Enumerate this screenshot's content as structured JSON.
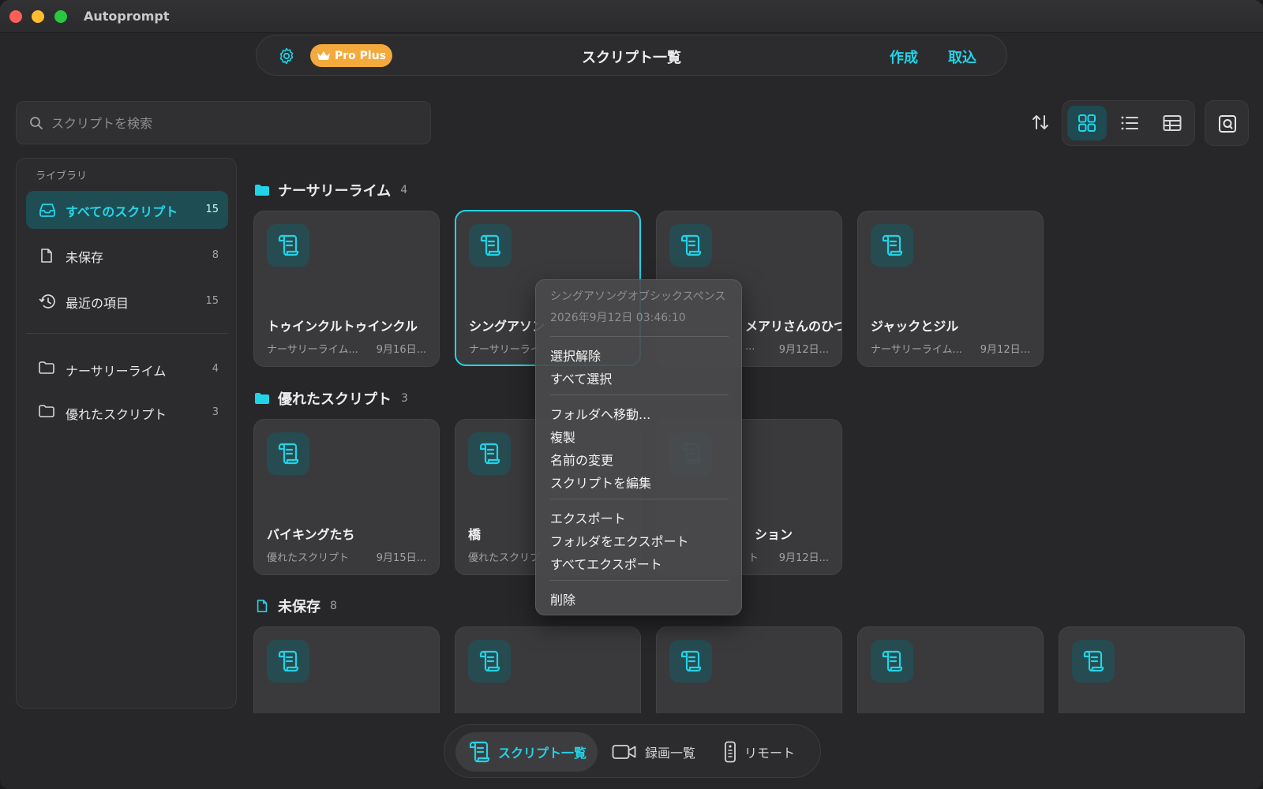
{
  "app": {
    "title": "Autoprompt"
  },
  "topbar": {
    "badge": "Pro Plus",
    "title": "スクリプト一覧",
    "create": "作成",
    "import": "取込"
  },
  "search": {
    "placeholder": "スクリプトを検索"
  },
  "sidebar": {
    "heading": "ライブラリ",
    "items": [
      {
        "label": "すべてのスクリプト",
        "count": "15",
        "icon": "tray-icon",
        "active": true
      },
      {
        "label": "未保存",
        "count": "8",
        "icon": "document-icon"
      },
      {
        "label": "最近の項目",
        "count": "15",
        "icon": "clock-history-icon"
      }
    ],
    "folders": [
      {
        "label": "ナーサリーライム",
        "count": "4",
        "icon": "folder-icon"
      },
      {
        "label": "優れたスクリプト",
        "count": "3",
        "icon": "folder-icon"
      }
    ]
  },
  "sections": [
    {
      "title": "ナーサリーライム",
      "count": "4",
      "icon": "folder-filled-icon",
      "cards": [
        {
          "title": "トゥインクルトゥインクル",
          "folder": "ナーサリーライム...",
          "date": "9月16日..."
        },
        {
          "title": "シングアソン",
          "folder": "ナーサリーライ",
          "date": ""
        },
        {
          "title": "メアリさんのひつじ",
          "folder": "...",
          "date": "9月12日..."
        },
        {
          "title": "ジャックとジル",
          "folder": "ナーサリーライム...",
          "date": "9月12日..."
        }
      ]
    },
    {
      "title": "優れたスクリプト",
      "count": "3",
      "icon": "folder-filled-icon",
      "cards": [
        {
          "title": "バイキングたち",
          "folder": "優れたスクリプト",
          "date": "9月15日..."
        },
        {
          "title": "橋",
          "folder": "優れたスクリプ",
          "date": ""
        },
        {
          "title": "ション",
          "folder": "ト",
          "date": "9月12日..."
        }
      ]
    },
    {
      "title": "未保存",
      "count": "8",
      "icon": "document-icon"
    }
  ],
  "context_menu": {
    "header_name": "シングアソングオブシックスペンス",
    "header_date": "2026年9月12日 03:46:10",
    "groups": [
      [
        "選択解除",
        "すべて選択"
      ],
      [
        "フォルダへ移動...",
        "複製",
        "名前の変更",
        "スクリプトを編集"
      ],
      [
        "エクスポート",
        "フォルダをエクスポート",
        "すべてエクスポート"
      ],
      [
        "削除"
      ]
    ]
  },
  "bottom_nav": {
    "scripts": "スクリプト一覧",
    "recordings": "録画一覧",
    "remote": "リモート"
  },
  "colors": {
    "accent": "#22d3e6",
    "badge": "#f4a93c",
    "background": "#272729"
  }
}
